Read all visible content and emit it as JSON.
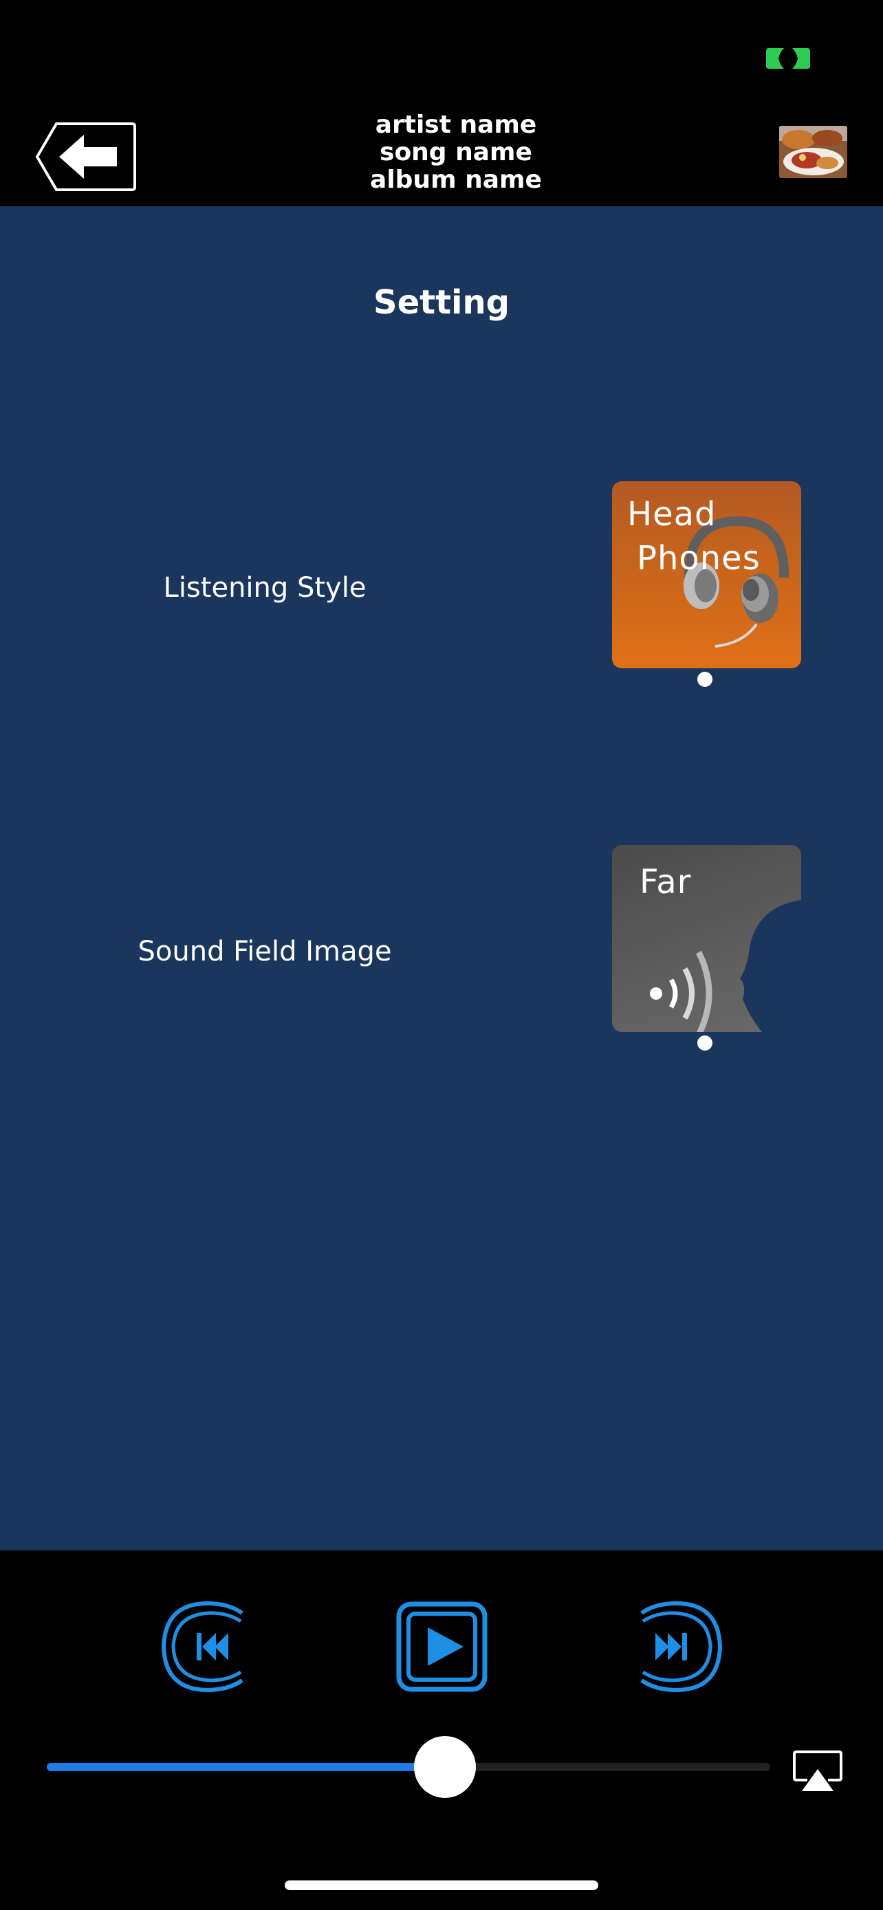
{
  "header": {
    "artist": "artist name",
    "song": "song name",
    "album": "album name"
  },
  "panel": {
    "title": "Setting"
  },
  "settings": [
    {
      "label": "Listening Style",
      "tile_line1": "Head",
      "tile_line2": "Phones",
      "icon": "headphones-icon"
    },
    {
      "label": "Sound Field Image",
      "tile_line1": "Far",
      "icon": "sound-wave-head-icon"
    }
  ],
  "player": {
    "progress_fraction": 0.55
  },
  "colors": {
    "panel_bg": "#1a365d",
    "accent_blue": "#1f7ce6",
    "headphones_tile": "#e07016",
    "far_tile": "#5a5a5a",
    "status_green": "#2ecc55"
  }
}
